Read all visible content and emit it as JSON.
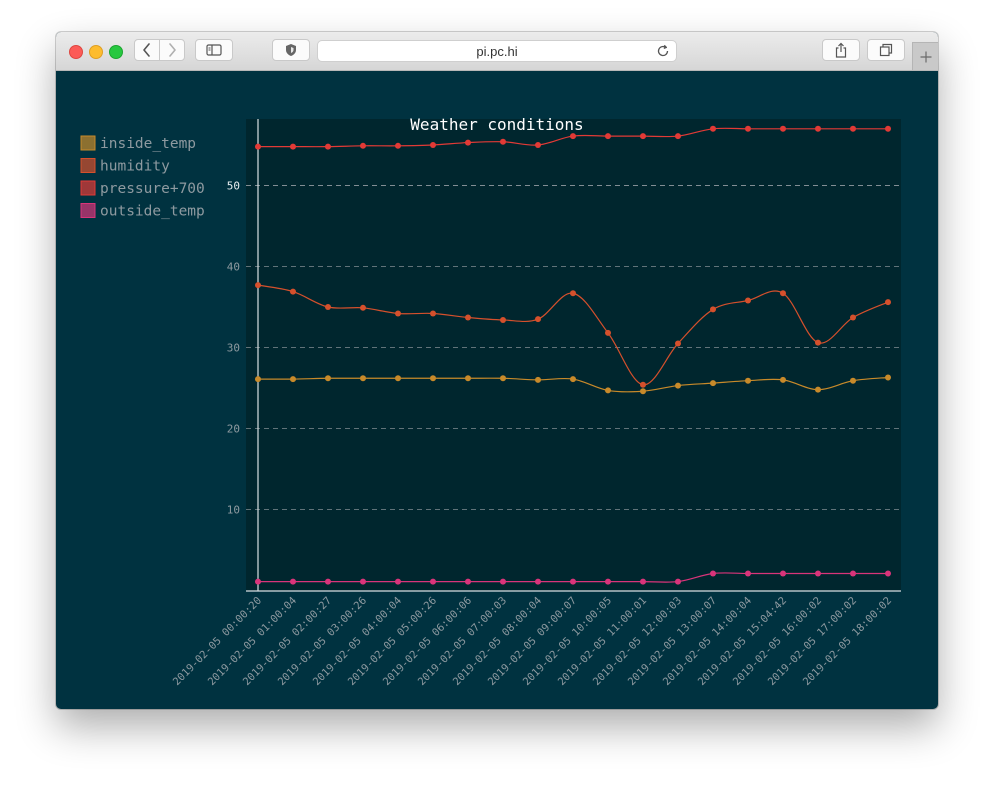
{
  "browser": {
    "url": "pi.pc.hi"
  },
  "colors": {
    "background": "#003240",
    "plot_background": "#00262e",
    "title": "#ffffff",
    "axis_text": "#8e9aa0",
    "gridline": "#8a949a"
  },
  "chart_data": {
    "type": "line",
    "title": "Weather conditions",
    "xlabel": "",
    "ylabel": "",
    "grid": true,
    "legend_position": "top-left",
    "ylim": [
      0,
      58
    ],
    "yticks": [
      10,
      20,
      30,
      40,
      50
    ],
    "categories": [
      "2019-02-05 00:00:20",
      "2019-02-05 01:00:04",
      "2019-02-05 02:00:27",
      "2019-02-05 03:00:26",
      "2019-02-05 04:00:04",
      "2019-02-05 05:00:26",
      "2019-02-05 06:00:06",
      "2019-02-05 07:00:03",
      "2019-02-05 08:00:04",
      "2019-02-05 09:00:07",
      "2019-02-05 10:00:05",
      "2019-02-05 11:00:01",
      "2019-02-05 12:00:03",
      "2019-02-05 13:00:07",
      "2019-02-05 14:00:04",
      "2019-02-05 15:04:42",
      "2019-02-05 16:00:02",
      "2019-02-05 17:00:02",
      "2019-02-05 18:00:02"
    ],
    "series": [
      {
        "name": "inside_temp",
        "color": "#c88a2a",
        "values": [
          26.1,
          26.1,
          26.2,
          26.2,
          26.2,
          26.2,
          26.2,
          26.2,
          26.0,
          26.1,
          24.7,
          24.6,
          25.3,
          25.6,
          25.9,
          26.0,
          24.8,
          25.9,
          26.3
        ]
      },
      {
        "name": "humidity",
        "color": "#d5502c",
        "values": [
          37.7,
          36.9,
          35.0,
          34.9,
          34.2,
          34.2,
          33.7,
          33.4,
          33.5,
          36.7,
          31.8,
          25.4,
          30.5,
          34.7,
          35.8,
          36.7,
          30.6,
          33.7,
          35.6
        ]
      },
      {
        "name": "pressure+700",
        "color": "#e23a36",
        "values": [
          54.8,
          54.8,
          54.8,
          54.9,
          54.9,
          55.0,
          55.3,
          55.4,
          55.0,
          56.1,
          56.1,
          56.1,
          56.1,
          57.0,
          57.0,
          57.0,
          57.0,
          57.0,
          57.0
        ]
      },
      {
        "name": "outside_temp",
        "color": "#d9347a",
        "values": [
          1.1,
          1.1,
          1.1,
          1.1,
          1.1,
          1.1,
          1.1,
          1.1,
          1.1,
          1.1,
          1.1,
          1.1,
          1.1,
          2.1,
          2.1,
          2.1,
          2.1,
          2.1,
          2.1
        ]
      }
    ]
  }
}
